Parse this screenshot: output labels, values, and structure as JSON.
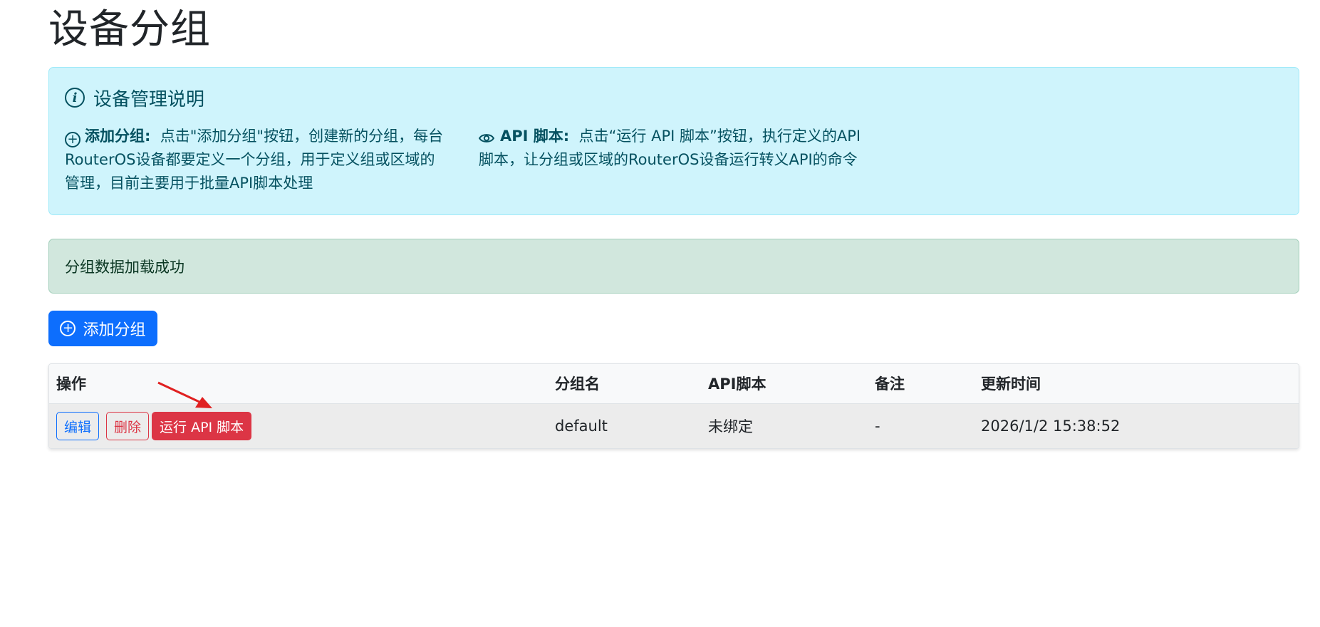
{
  "page": {
    "title": "设备分组"
  },
  "info": {
    "heading": "设备管理说明",
    "add_group": {
      "label": "添加分组:",
      "text": "点击\"添加分组\"按钮，创建新的分组，每台RouterOS设备都要定义一个分组，用于定义组或区域的管理，目前主要用于批量API脚本处理"
    },
    "api_script": {
      "label": "API 脚本:",
      "text": "点击“运行 API 脚本”按钮，执行定义的API 脚本，让分组或区域的RouterOS设备运行转义API的命令"
    }
  },
  "alert": {
    "success": "分组数据加载成功"
  },
  "toolbar": {
    "add_group_label": "添加分组"
  },
  "table": {
    "headers": [
      "操作",
      "分组名",
      "API脚本",
      "备注",
      "更新时间"
    ],
    "rows": [
      {
        "actions": {
          "edit": "编辑",
          "delete": "删除",
          "run": "运行 API 脚本"
        },
        "name": "default",
        "api_script": "未绑定",
        "note": "-",
        "updated": "2026/1/2 15:38:52"
      }
    ]
  },
  "colors": {
    "primary": "#0d6efd",
    "danger": "#dc3545",
    "info_bg": "#cff4fc",
    "success_bg": "#d1e7dd",
    "annotation_arrow": "#e02020"
  },
  "icons": {
    "info": "info-circle-icon",
    "add": "plus-circle-icon",
    "api": "eye-icon"
  }
}
